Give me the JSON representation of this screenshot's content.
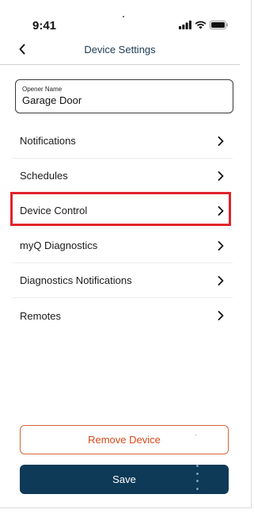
{
  "status_bar": {
    "time": "9:41",
    "icons": [
      "cellular-signal-icon",
      "wifi-icon",
      "battery-icon"
    ]
  },
  "header": {
    "title": "Device Settings",
    "back_icon": "chevron-left-icon"
  },
  "opener_name": {
    "label": "Opener Name",
    "value": "Garage Door"
  },
  "menu": {
    "items": [
      {
        "label": "Notifications"
      },
      {
        "label": "Schedules"
      },
      {
        "label": "Device Control"
      },
      {
        "label": "myQ Diagnostics"
      },
      {
        "label": "Diagnostics Notifications"
      },
      {
        "label": "Remotes"
      }
    ],
    "highlighted_item": "Device Control",
    "highlight_color": "#e0242b"
  },
  "actions": {
    "remove_label": "Remove Device",
    "save_label": "Save"
  },
  "colors": {
    "primary": "#0e3a57",
    "remove_accent": "#d64a1c",
    "title_text": "#1d3b52"
  }
}
